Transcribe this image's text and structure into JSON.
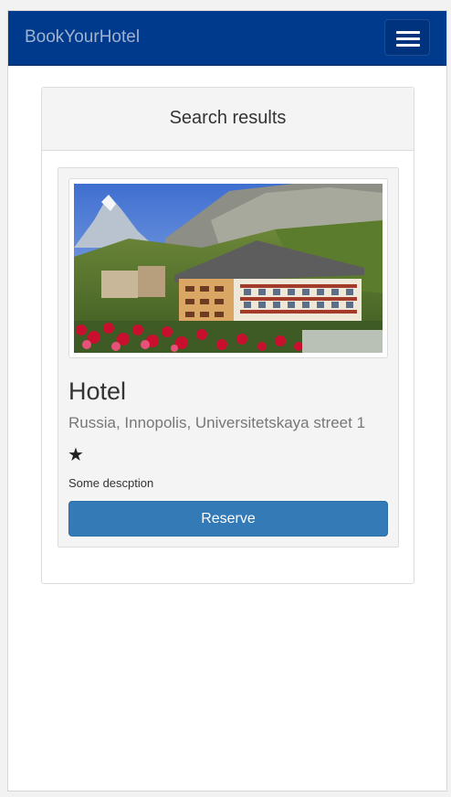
{
  "navbar": {
    "brand": "BookYourHotel",
    "menu_icon": "hamburger-menu-icon"
  },
  "results": {
    "heading": "Search results",
    "items": [
      {
        "image": "hotel-photo",
        "name": "Hotel",
        "address": "Russia, Innopolis, Universitetskaya street 1",
        "stars": "★",
        "star_count": 1,
        "description": "Some descption",
        "reserve_label": "Reserve"
      }
    ]
  },
  "colors": {
    "navbar_bg": "#003a8c",
    "brand_text": "#9fb2cf",
    "button_primary": "#337ab7"
  }
}
